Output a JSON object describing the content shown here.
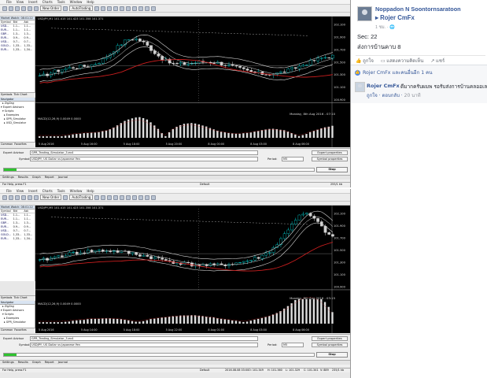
{
  "mt4_menu": [
    "File",
    "View",
    "Insert",
    "Charts",
    "Tools",
    "Window",
    "Help"
  ],
  "toolbar": {
    "new_order": "New Order",
    "autotrading": "AutoTrading"
  },
  "market_watch": {
    "title": "Market Watch: 08:01:22",
    "headers": [
      "Symbol",
      "Bid",
      "Ask"
    ],
    "rows": [
      {
        "symbol": "USD...",
        "bid": "1.1...",
        "ask": "1.1..."
      },
      {
        "symbol": "EUR...",
        "bid": "1.1...",
        "ask": "1.1..."
      },
      {
        "symbol": "GBP...",
        "bid": "1.3...",
        "ask": "1.3..."
      },
      {
        "symbol": "EUR...",
        "bid": "0.9...",
        "ask": "0.9..."
      },
      {
        "symbol": "USD...",
        "bid": "0.7...",
        "ask": "0.7..."
      },
      {
        "symbol": "GOLD...",
        "bid": "1,33...",
        "ask": "1,33..."
      },
      {
        "symbol": "EUR...",
        "bid": "1,33...",
        "ask": "1,34..."
      }
    ],
    "tabs": [
      "Symbols",
      "Tick Chart"
    ]
  },
  "navigator": {
    "title": "Navigator",
    "items": [
      "ZigZag",
      "Expert Advisors",
      "Scripts",
      "Examples",
      "GPR_Simulator",
      "USD_Simulator"
    ],
    "tabs": [
      "Common",
      "Favorites"
    ]
  },
  "chart1": {
    "title": "USDJPY,M1  101.415 101.423 101.358 101.371",
    "subwindow": "MACD(12,26,9) 0.0049 0.0000",
    "date_label": "Monday, 8th Aug 2016 - 07:10",
    "price_ticks": [
      "102.100",
      "101.900",
      "101.700",
      "101.500",
      "101.300",
      "101.100",
      "100.900"
    ],
    "time_ticks": [
      "5 Aug 2016",
      "5 Aug 16:00",
      "5 Aug 18:00",
      "5 Aug 20:00",
      "8 Aug 00:00",
      "8 Aug 03:00",
      "8 Aug 06:00"
    ]
  },
  "chart2": {
    "title": "USDJPY,M5  101.415 101.423 101.358 101.371",
    "subwindow": "MACD(12,26,9) 0.0049 0.0000",
    "date_label": "Monday, 8th Aug 2016 - 03:15",
    "price_ticks": [
      "102.100",
      "101.900",
      "101.700",
      "101.500",
      "101.300",
      "101.100",
      "100.900"
    ],
    "time_ticks": [
      "5 Aug 2016",
      "5 Aug 14:00",
      "5 Aug 18:00",
      "5 Aug 22:00",
      "8 Aug 01:00",
      "8 Aug 03:00",
      "8 Aug 06:00"
    ]
  },
  "tester": {
    "expert_label": "Expert Advisor",
    "expert_value": "GPR_Trading_Simulator_3.ex4",
    "symbol_label": "Symbol:",
    "symbol_value": "USDJPY, US Dollar vs Japanese Yen",
    "period_label": "Period:",
    "period_value": "M5",
    "expert_props": "Expert properties",
    "symbol_props": "Symbol properties",
    "start": "Stop",
    "progress_pct": 4,
    "tabs": [
      "Settings",
      "Results",
      "Graph",
      "Report",
      "Journal"
    ]
  },
  "status1": {
    "help": "For Help, press F1",
    "profile": "Default",
    "traffic": "255/1 kb"
  },
  "status2": {
    "help": "For Help, press F1",
    "profile": "Default",
    "datetime": "2016.08.08 03:00",
    "o": "O: 101.349",
    "h": "H: 101.360",
    "l": "L: 101.329",
    "c": "C: 101.341",
    "v": "V: 889",
    "traffic": "235/1 kb"
  },
  "post": {
    "author": "Noppadon N Soontornsaratoon",
    "target": "Rojer CmFx",
    "time": "1 ชม. · 🌐",
    "line1": "Sec: 22",
    "line2": "ส่งการบ้านคาบ 8",
    "like": "ถูกใจ",
    "comment": "แสดงความคิดเห็น",
    "share": "แชร์"
  },
  "reactions": "Rojer CmFx และคนอื่นอีก 1 คน",
  "comment": {
    "name": "Rojer CmFx",
    "text": "ดีมากครับผมพ รอรับส่งการบ้านคลออเลอคลับ",
    "like": "ถูกใจ",
    "reply": "ตอบกลับ",
    "time": "20 นาที"
  },
  "colors": {
    "chart_bg": "#000000",
    "bull": "#00d0d0",
    "bear": "#d0d0d0",
    "ma_red": "#c81e1e",
    "fb_blue": "#365899",
    "progress": "#2fc32f"
  }
}
